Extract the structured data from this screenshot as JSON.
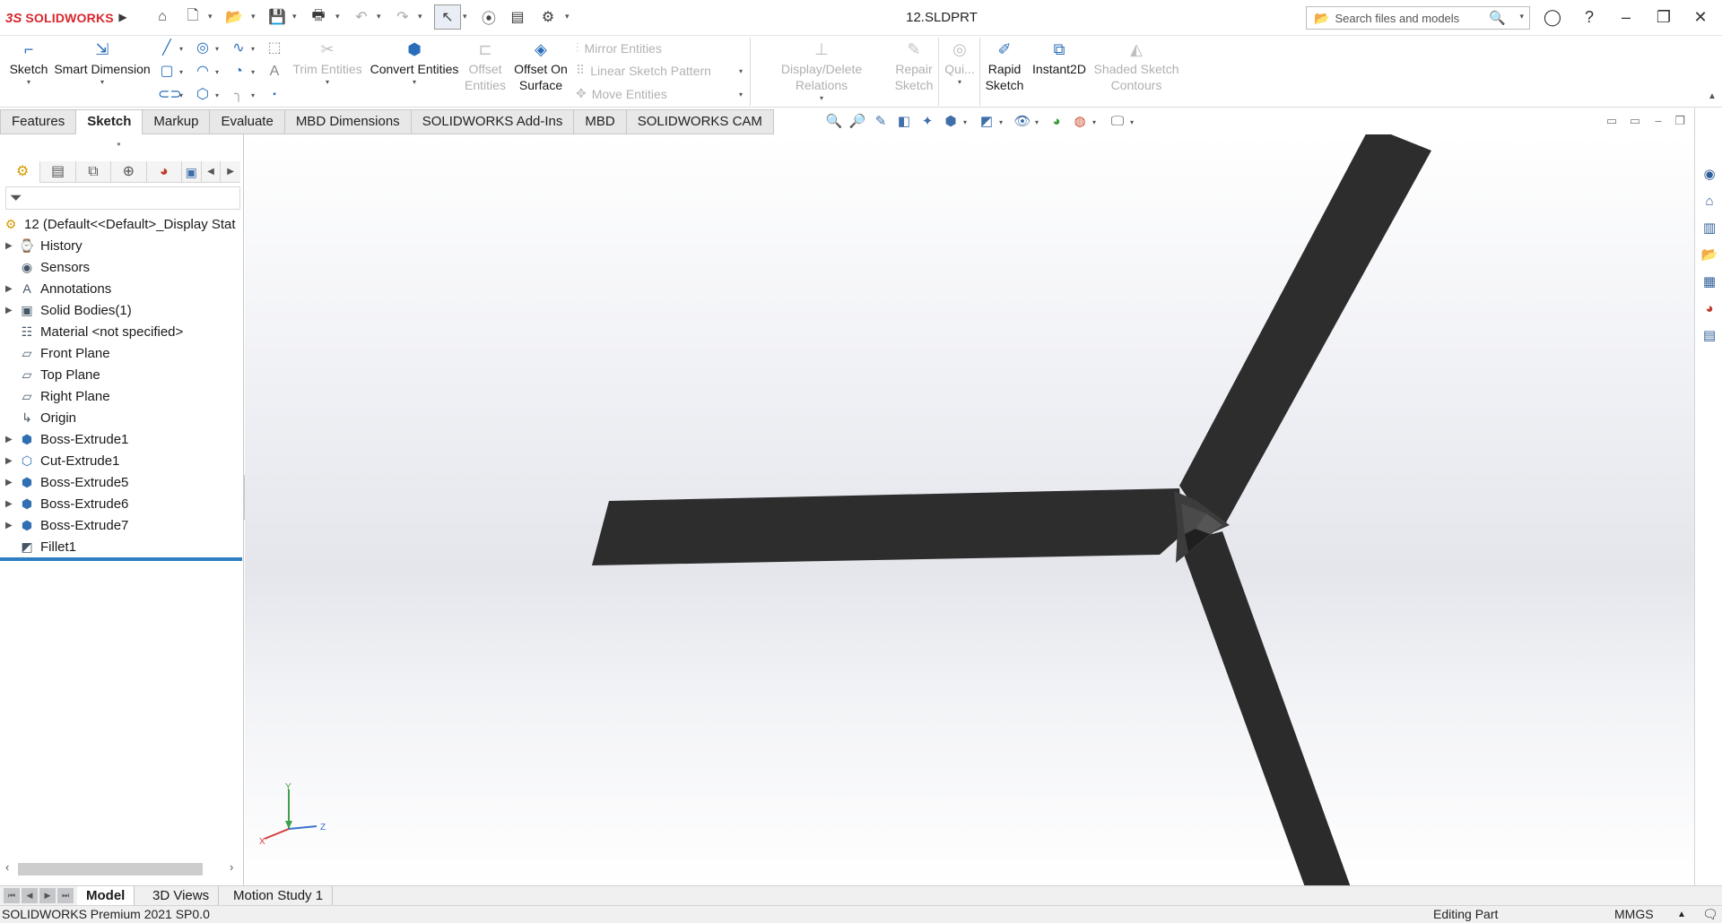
{
  "titlebar": {
    "brand": "SOLIDWORKS",
    "document_title": "12.SLDPRT",
    "search_placeholder": "Search files and models",
    "icons": [
      "home-icon",
      "new-document-icon",
      "open-icon",
      "save-icon",
      "print-icon",
      "undo-icon",
      "redo-icon",
      "select-icon",
      "rebuild-icon",
      "file-properties-icon",
      "options-icon",
      "user-icon",
      "help-icon",
      "minimize-icon",
      "restore-icon",
      "close-icon"
    ]
  },
  "command_manager": {
    "sketch": "Sketch",
    "smart_dimension": "Smart Dimension",
    "trim_entities": "Trim Entities",
    "convert_entities": "Convert Entities",
    "offset_entities_1": "Offset",
    "offset_entities_2": "Entities",
    "offset_on_surface_1": "Offset On",
    "offset_on_surface_2": "Surface",
    "mirror_entities": "Mirror Entities",
    "linear_sketch_pattern": "Linear Sketch Pattern",
    "move_entities": "Move Entities",
    "display_delete_relations": "Display/Delete Relations",
    "repair_sketch_1": "Repair",
    "repair_sketch_2": "Sketch",
    "quick_snaps": "Qui...",
    "rapid_sketch_1": "Rapid",
    "rapid_sketch_2": "Sketch",
    "instant2d": "Instant2D",
    "shaded_sketch_contours_1": "Shaded Sketch",
    "shaded_sketch_contours_2": "Contours"
  },
  "tabs": [
    {
      "label": "Features",
      "active": false
    },
    {
      "label": "Sketch",
      "active": true
    },
    {
      "label": "Markup",
      "active": false
    },
    {
      "label": "Evaluate",
      "active": false
    },
    {
      "label": "MBD Dimensions",
      "active": false
    },
    {
      "label": "SOLIDWORKS Add-Ins",
      "active": false
    },
    {
      "label": "MBD",
      "active": false
    },
    {
      "label": "SOLIDWORKS CAM",
      "active": false
    }
  ],
  "feature_tree": {
    "root": "12  (Default<<Default>_Display Stat",
    "items": [
      {
        "label": "History",
        "expandable": true,
        "icon": "history-icon"
      },
      {
        "label": "Sensors",
        "expandable": false,
        "icon": "sensors-icon"
      },
      {
        "label": "Annotations",
        "expandable": true,
        "icon": "annotations-icon"
      },
      {
        "label": "Solid Bodies(1)",
        "expandable": true,
        "icon": "solid-bodies-icon"
      },
      {
        "label": "Material <not specified>",
        "expandable": false,
        "icon": "material-icon"
      },
      {
        "label": "Front Plane",
        "expandable": false,
        "icon": "plane-icon"
      },
      {
        "label": "Top Plane",
        "expandable": false,
        "icon": "plane-icon"
      },
      {
        "label": "Right Plane",
        "expandable": false,
        "icon": "plane-icon"
      },
      {
        "label": "Origin",
        "expandable": false,
        "icon": "origin-icon"
      },
      {
        "label": "Boss-Extrude1",
        "expandable": true,
        "icon": "boss-extrude-icon"
      },
      {
        "label": "Cut-Extrude1",
        "expandable": true,
        "icon": "cut-extrude-icon"
      },
      {
        "label": "Boss-Extrude5",
        "expandable": true,
        "icon": "boss-extrude-icon"
      },
      {
        "label": "Boss-Extrude6",
        "expandable": true,
        "icon": "boss-extrude-icon"
      },
      {
        "label": "Boss-Extrude7",
        "expandable": true,
        "icon": "boss-extrude-icon"
      },
      {
        "label": "Fillet1",
        "expandable": false,
        "icon": "fillet-icon"
      }
    ]
  },
  "triad": {
    "x": "X",
    "y": "Y",
    "z": "Z"
  },
  "bottom_tabs": [
    {
      "label": "Model",
      "active": true
    },
    {
      "label": "3D Views",
      "active": false
    },
    {
      "label": "Motion Study 1",
      "active": false
    }
  ],
  "status": {
    "product": "SOLIDWORKS Premium 2021 SP0.0",
    "mode": "Editing Part",
    "units": "MMGS"
  },
  "colors": {
    "brand_red": "#d8272e",
    "accent_blue": "#2e7ec4",
    "model_face": "#2d2d2d"
  }
}
